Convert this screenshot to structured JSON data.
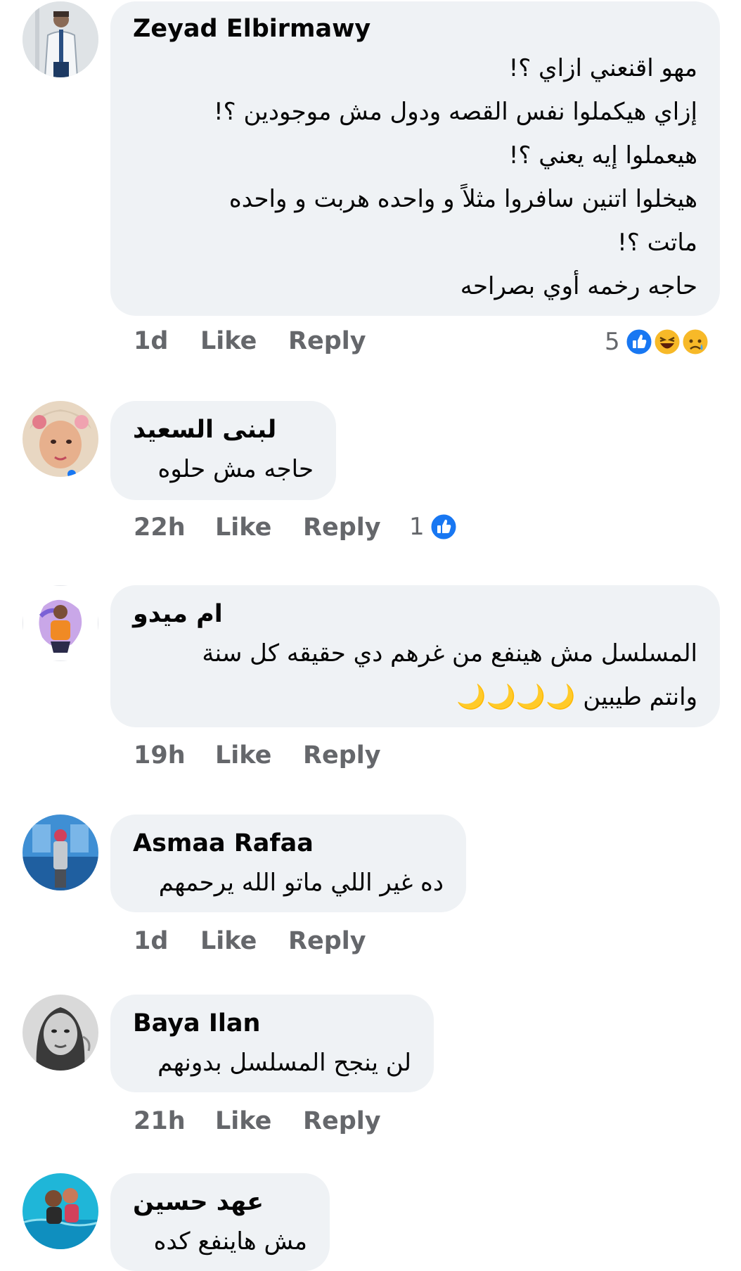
{
  "comments": [
    {
      "author": "Zeyad Elbirmawy",
      "lines": [
        "مهو اقنعني ازاي ؟!",
        "إزاي هيكملوا نفس القصه ودول مش موجودين ؟!",
        "هيعملوا إيه يعني ؟!",
        "هيخلوا اتنين سافروا مثلاً و واحده هربت و واحده",
        "ماتت ؟!",
        "حاجه رخمه أوي بصراحه"
      ],
      "time": "1d",
      "like_label": "Like",
      "reply_label": "Reply",
      "reaction_count": "5",
      "reactions": [
        "like-icon",
        "haha-icon",
        "sad-icon"
      ]
    },
    {
      "author": "لبنى السعيد",
      "lines": [
        "حاجه مش حلوه"
      ],
      "time": "22h",
      "like_label": "Like",
      "reply_label": "Reply",
      "reaction_count": "1",
      "reactions": [
        "like-icon"
      ]
    },
    {
      "author": "ام ميدو",
      "lines": [
        "المسلسل مش هينفع من غرهم دي حقيقه كل سنة",
        "وانتم طيبين 🌙🌙🌙🌙"
      ],
      "time": "19h",
      "like_label": "Like",
      "reply_label": "Reply"
    },
    {
      "author": "Asmaa Rafaa",
      "lines": [
        "ده غير اللي ماتو الله يرحمهم"
      ],
      "time": "1d",
      "like_label": "Like",
      "reply_label": "Reply"
    },
    {
      "author": "Baya Ilan",
      "lines": [
        "لن ينجح المسلسل بدونهم"
      ],
      "time": "21h",
      "like_label": "Like",
      "reply_label": "Reply"
    },
    {
      "author": "عهد حسين",
      "lines": [
        "مش هاينفع كده"
      ]
    }
  ],
  "colors": {
    "bubble": "#eff2f5",
    "meta_text": "#65676b",
    "like_blue": "#1877f2",
    "haha_yellow": "#f7b928"
  }
}
